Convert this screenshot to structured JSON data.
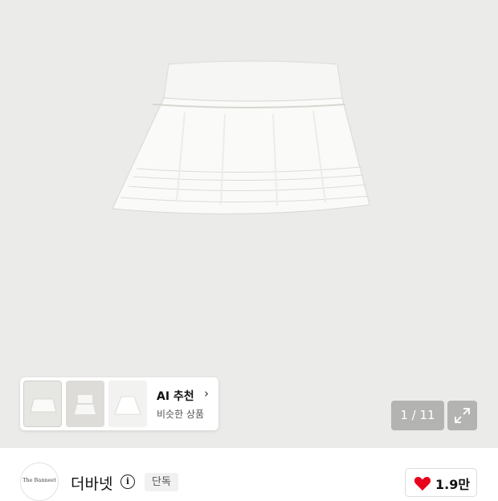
{
  "gallery": {
    "main_image": "white-tiered-lace-mini-skirt",
    "ai_card": {
      "thumbnails": [
        "skirt-thumbnail",
        "top-and-skirt-thumbnail",
        "skirt-thumbnail"
      ],
      "title": "AI 추천",
      "subtitle": "비슷한 상품"
    },
    "pager": "1 / 11"
  },
  "store": {
    "logo_text": "The Banneet",
    "name": "더바넷",
    "badge": "단독",
    "likes": "1.9만"
  },
  "colors": {
    "heart": "#e8001c",
    "background": "#ebebe9"
  }
}
